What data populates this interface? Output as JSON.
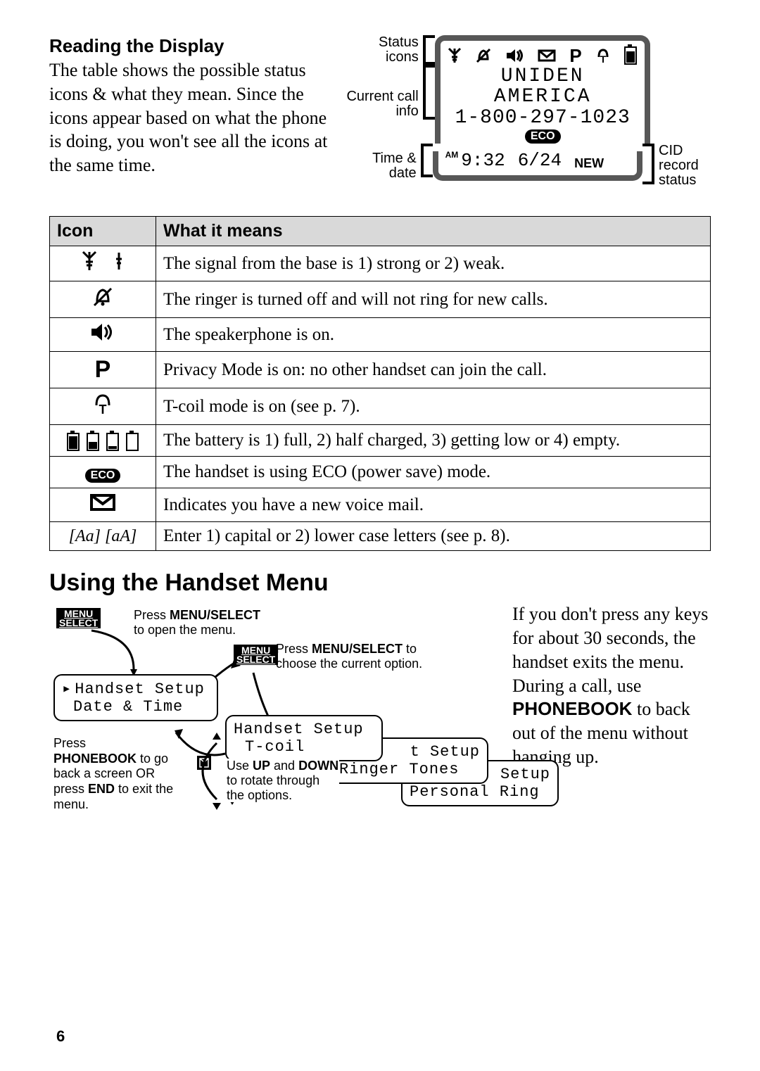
{
  "intro": {
    "heading": "Reading the Display",
    "text": "The table shows the possible status icons & what they mean. Since the icons appear based on what the phone is doing, you won't see all the icons at the same time."
  },
  "display_diagram": {
    "labels": {
      "status_icons": "Status icons",
      "current_call": "Current call info",
      "time_date": "Time & date",
      "cid": "CID record status"
    },
    "screen": {
      "caller_name": "UNIDEN AMERICA",
      "caller_number": "1-800-297-1023",
      "eco": "ECO",
      "ampm": "AM",
      "time": "9:32",
      "date": "6/24",
      "new": "NEW"
    }
  },
  "table": {
    "head_icon": "Icon",
    "head_meaning": "What it means",
    "rows": [
      {
        "icon_name": "signal-icon",
        "icon_text": "",
        "meaning": "The signal from the base is 1) strong or 2) weak."
      },
      {
        "icon_name": "ringer-off-icon",
        "icon_text": "",
        "meaning": "The ringer is turned off and will not ring for new calls."
      },
      {
        "icon_name": "speakerphone-icon",
        "icon_text": "",
        "meaning": "The speakerphone is on."
      },
      {
        "icon_name": "privacy-icon",
        "icon_text": "P",
        "meaning": "Privacy Mode is on: no other handset can join the call."
      },
      {
        "icon_name": "tcoil-icon",
        "icon_text": "",
        "meaning": "T-coil mode is on (see p. 7)."
      },
      {
        "icon_name": "battery-icon",
        "icon_text": "",
        "meaning": "The battery is 1) full, 2) half charged, 3) getting low or 4) empty."
      },
      {
        "icon_name": "eco-icon",
        "icon_text": "ECO",
        "meaning": "The handset is using ECO (power save) mode."
      },
      {
        "icon_name": "voicemail-icon",
        "icon_text": "",
        "meaning": "Indicates you have a new voice mail."
      },
      {
        "icon_name": "case-icon",
        "icon_text": "[Aa] [aA]",
        "meaning": "Enter 1) capital or 2) lower case letters (see p. 8)."
      }
    ]
  },
  "section2_heading": "Using the Handset Menu",
  "menu_text": {
    "line1": "If you don't press any keys for about 30 seconds, the handset exits the menu.",
    "line2a": "During a call, use ",
    "phonebook": "PHONEBOOK",
    "line2b": " to back out of the menu without hanging up."
  },
  "menu_diagram": {
    "menu_select": "MENU\nSELECT",
    "cap_open_a": "Press ",
    "cap_open_b": "MENU/SELECT",
    "cap_open_c": " to open the menu.",
    "cap_choose_a": "Press ",
    "cap_choose_b": "MENU/SELECT",
    "cap_choose_c": " to choose the current option.",
    "screen1_line1": "Handset Setup",
    "screen1_line2": "Date & Time",
    "screen2_line1": "Handset Setup",
    "screen2_line2": "T-coil",
    "screen3_suffix": "t Setup",
    "screen3_line2": "Ringer Tones",
    "screen4_suffix": "t Setup",
    "screen4_line2": "Personal Ring",
    "cap_back_a": "Press ",
    "cap_back_b": "PHONEBOOK",
    "cap_back_c": " to go back a screen OR press ",
    "cap_back_d": "END",
    "cap_back_e": " to exit the menu.",
    "cap_updown_a": "Use ",
    "cap_updown_b": "UP",
    "cap_updown_c": " and ",
    "cap_updown_d": "DOWN",
    "cap_updown_e": " to rotate through the options."
  },
  "page_number": "6"
}
